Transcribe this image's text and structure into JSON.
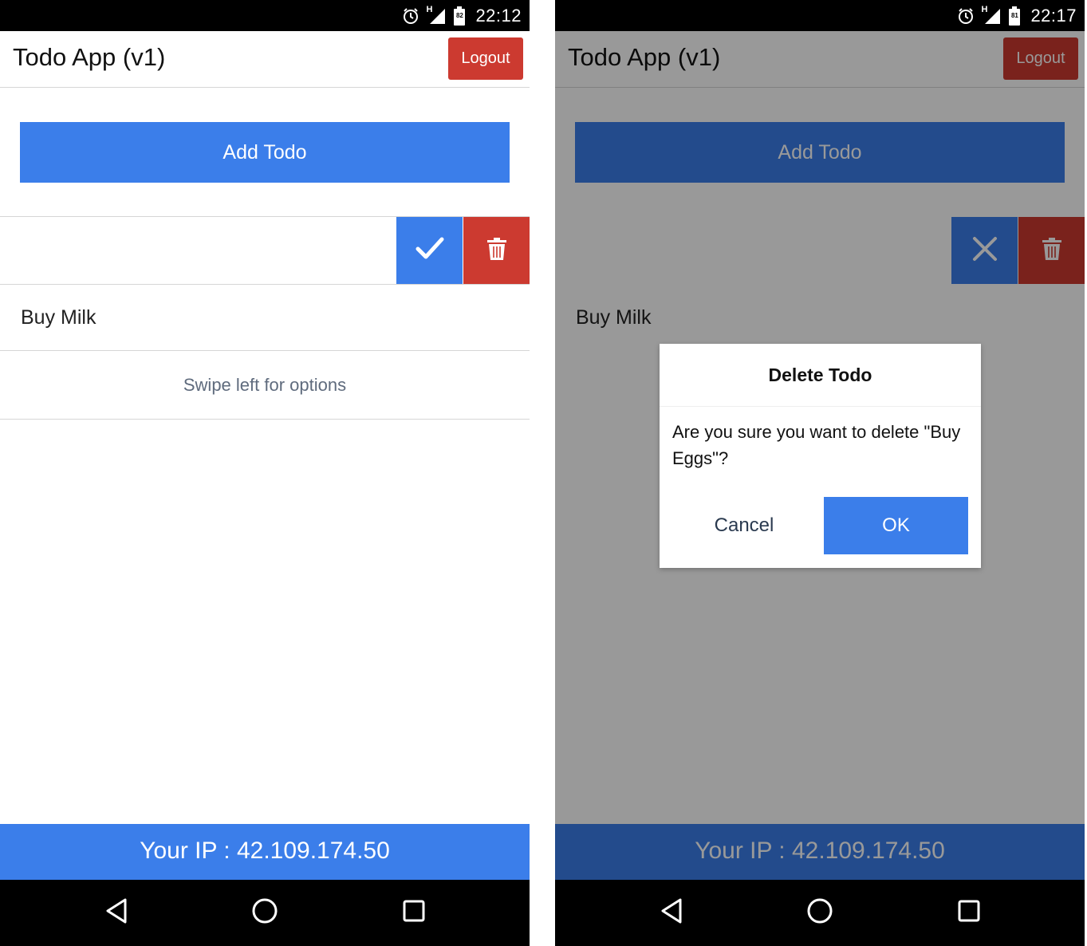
{
  "left": {
    "status_time": "22:12",
    "battery_level": "82",
    "app_title": "Todo App (v1)",
    "logout_label": "Logout",
    "add_todo_label": "Add Todo",
    "swiped_row_actions": [
      "checkmark-icon",
      "trash-icon"
    ],
    "todos": [
      "Buy Milk"
    ],
    "hint": "Swipe left for options",
    "footer": "Your IP : 42.109.174.50"
  },
  "right": {
    "status_time": "22:17",
    "battery_level": "81",
    "app_title": "Todo App (v1)",
    "logout_label": "Logout",
    "add_todo_label": "Add Todo",
    "swiped_row_actions": [
      "close-icon",
      "trash-icon"
    ],
    "todos": [
      "Buy Milk"
    ],
    "footer": "Your IP : 42.109.174.50",
    "dialog": {
      "title": "Delete Todo",
      "message": "Are you sure you want to delete \"Buy Eggs\"?",
      "cancel_label": "Cancel",
      "ok_label": "OK"
    }
  },
  "network_indicator": "H",
  "colors": {
    "primary_blue": "#3b7eea",
    "danger_red": "#cc3a30",
    "bar_black": "#000000"
  }
}
